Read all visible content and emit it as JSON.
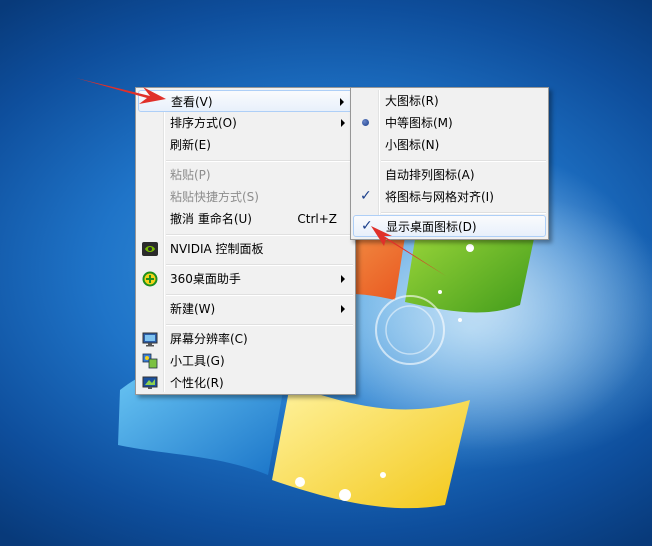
{
  "main_menu": {
    "items": [
      {
        "label": "查看(V)"
      },
      {
        "label": "排序方式(O)"
      },
      {
        "label": "刷新(E)"
      },
      {
        "label": "粘贴(P)"
      },
      {
        "label": "粘贴快捷方式(S)"
      },
      {
        "label": "撤消 重命名(U)",
        "shortcut": "Ctrl+Z"
      },
      {
        "label": "NVIDIA 控制面板",
        "icon": "nvidia-icon"
      },
      {
        "label": "360桌面助手",
        "icon": "360-icon"
      },
      {
        "label": "新建(W)"
      },
      {
        "label": "屏幕分辨率(C)",
        "icon": "monitor-icon"
      },
      {
        "label": "小工具(G)",
        "icon": "gadgets-icon"
      },
      {
        "label": "个性化(R)",
        "icon": "personalize-icon"
      }
    ]
  },
  "view_submenu": {
    "items": [
      {
        "label": "大图标(R)"
      },
      {
        "label": "中等图标(M)",
        "selected": true
      },
      {
        "label": "小图标(N)"
      },
      {
        "label": "自动排列图标(A)"
      },
      {
        "label": "将图标与网格对齐(I)",
        "checked": true
      },
      {
        "label": "显示桌面图标(D)",
        "checked": true
      }
    ]
  },
  "colors": {
    "accent_arrow": "#e0302a",
    "menu_bg": "#f1f1f1",
    "highlight_border": "#aecff7"
  }
}
